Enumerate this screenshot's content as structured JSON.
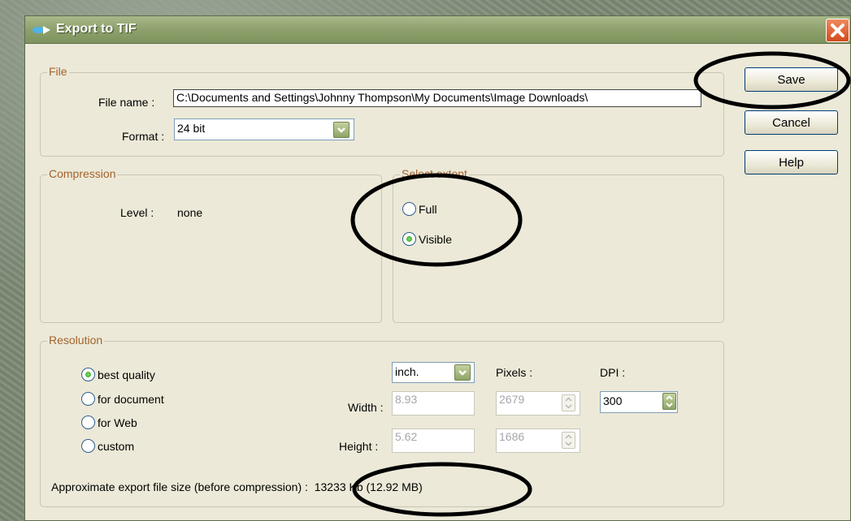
{
  "window": {
    "title": "Export to TIF"
  },
  "file": {
    "legend": "File",
    "filename_label": "File name :",
    "filename_value": "C:\\Documents and Settings\\Johnny Thompson\\My Documents\\Image Downloads\\",
    "format_label": "Format :",
    "format_value": "24 bit"
  },
  "buttons": {
    "save": "Save",
    "cancel": "Cancel",
    "help": "Help"
  },
  "compression": {
    "legend": "Compression",
    "level_label": "Level :",
    "level_value": "none"
  },
  "extent": {
    "legend": "Select extent",
    "full": "Full",
    "visible": "Visible",
    "selected": "Visible"
  },
  "resolution": {
    "legend": "Resolution",
    "options": [
      "best quality",
      "for document",
      "for Web",
      "custom"
    ],
    "selected": "best quality",
    "unit": "inch.",
    "pixels_label": "Pixels :",
    "dpi_label": "DPI :",
    "width_label": "Width :",
    "height_label": "Height :",
    "width_value": "8.93",
    "height_value": "5.62",
    "width_pixels": "2679",
    "height_pixels": "1686",
    "dpi_value": "300"
  },
  "filesize": {
    "text": "Approximate export file size (before compression) :  13233 Kb (12.92 MB)"
  },
  "icons": {
    "title": "export-arrow-icon",
    "close": "close-x-icon",
    "dropdown": "chevron-down-icon",
    "spinner": "spinner-arrows-icon"
  },
  "colors": {
    "legend_text": "#a4622c",
    "titlebar": "#8ea16c",
    "close": "#d24a1b",
    "dialog_bg": "#ece9d8"
  }
}
